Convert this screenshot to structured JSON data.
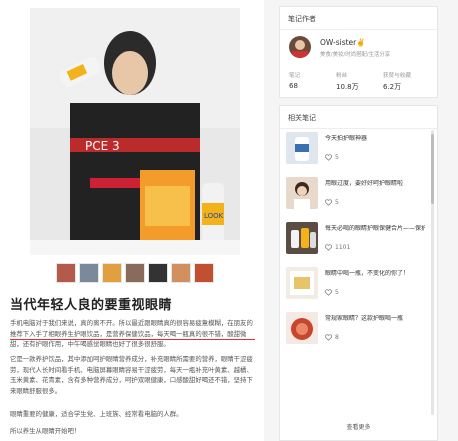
{
  "post": {
    "title": "当代年轻人良的要重视眼睛",
    "paragraph1": "手机电脑对于我们来说，真的离不开。所以最近跟眼睛真的很容易疲惫模糊，在朋友的推荐下入手了相眼养生护眼饮品，是营养保健饮品，每天喝一瓶真的很不错，酸甜微甜，还有护眼作用，中午喝感觉眼睛也好了很多很舒服。",
    "paragraph2": "它是一款养护饮品，其中添加呵护眼睛营养成分，补充眼睛所需要的营养，眼睛干涩疲劳，现代人长时间看手机、电脑屏幕眼睛容易干涩疲劳，每天一瓶补充叶黄素、越橘、玉米黄素、花青素，含有多种营养成分，呵护双眼健康，口感酸甜好喝还不错，坚持下来眼睛舒服很多。",
    "paragraph3": "眼睛重要的健康，适合学生党、上班族、经常看电脑的人群。",
    "paragraph4": "所以养生从眼睛开始吧！"
  },
  "thumbnails": [
    "thumb-1",
    "thumb-2",
    "thumb-3",
    "thumb-4",
    "thumb-5",
    "thumb-6",
    "thumb-7"
  ],
  "author": {
    "card_title": "笔记作者",
    "name": "OW-sister✌️",
    "tags": "美食/美妆/时尚搭配/生活分享",
    "stats": [
      {
        "label": "笔记",
        "value": "68"
      },
      {
        "label": "粉丝",
        "value": "10.8万"
      },
      {
        "label": "获赞与收藏",
        "value": "6.2万"
      }
    ]
  },
  "related": {
    "card_title": "相关笔记",
    "items": [
      {
        "title": "今天拍护眼神器",
        "likes": "5"
      },
      {
        "title": "用眼过度，要好好呵护眼睛啦",
        "likes": "5"
      },
      {
        "title": "每天必喝的眼睛护眼保健合片——保护眼睛必备",
        "likes": "1101"
      },
      {
        "title": "眼睛中喝一瓶，不变化的你了！",
        "likes": "5"
      },
      {
        "title": "常规家眼睛？这款护眼喝一瓶",
        "likes": "8"
      }
    ],
    "view_more": "查看更多"
  },
  "colors": {
    "accent_red": "#d33333",
    "card_border": "#e6e6e6"
  }
}
